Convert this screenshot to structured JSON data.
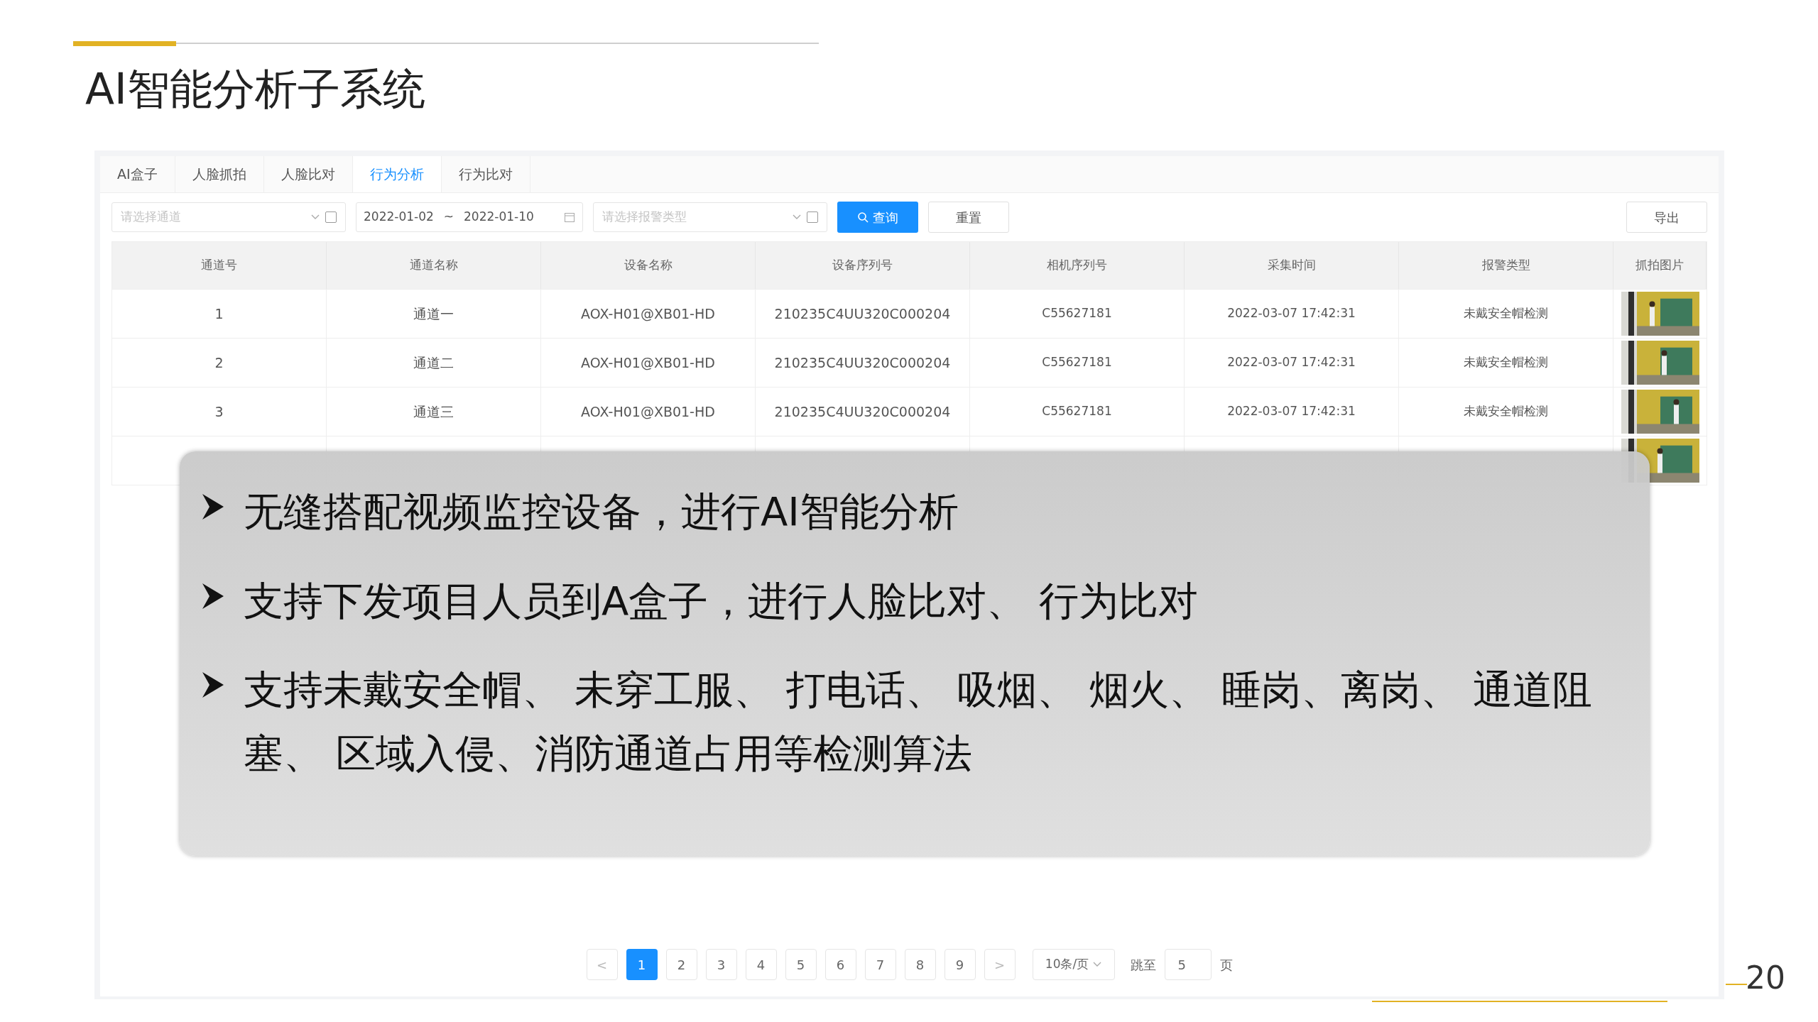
{
  "slide": {
    "title": "AI智能分析子系统",
    "page_number": "20"
  },
  "tabs": [
    {
      "label": "AI盒子",
      "selected": false
    },
    {
      "label": "人脸抓拍",
      "selected": false
    },
    {
      "label": "人脸比对",
      "selected": false
    },
    {
      "label": "行为分析",
      "selected": true
    },
    {
      "label": "行为比对",
      "selected": false
    }
  ],
  "filters": {
    "channel": {
      "placeholder": "请选择通道",
      "checked": false
    },
    "date_from": "2022-01-02",
    "date_sep": "~",
    "date_to": "2022-01-10",
    "alarm_type": {
      "placeholder": "请选择报警类型",
      "checked": false
    },
    "query_button": "查询",
    "reset_button": "重置",
    "export_button": "导出"
  },
  "table": {
    "columns": [
      "通道号",
      "通道名称",
      "设备名称",
      "设备序列号",
      "相机序列号",
      "采集时间",
      "报警类型",
      "抓拍图片"
    ],
    "rows": [
      {
        "cells": [
          "1",
          "通道一",
          "AOX-H01@XB01-HD",
          "210235C4UU320C000204",
          "C55627181",
          "2022-03-07 17:42:31",
          "未戴安全帽检测"
        ],
        "snapshot": {
          "kind": "picture"
        }
      },
      {
        "cells": [
          "2",
          "通道二",
          "AOX-H01@XB01-HD",
          "210235C4UU320C000204",
          "C55627181",
          "2022-03-07 17:42:31",
          "未戴安全帽检测"
        ],
        "snapshot": {
          "kind": "picture"
        }
      },
      {
        "cells": [
          "3",
          "通道三",
          "AOX-H01@XB01-HD",
          "210235C4UU320C000204",
          "C55627181",
          "2022-03-07 17:42:31",
          "未戴安全帽检测"
        ],
        "snapshot": {
          "kind": "picture"
        }
      },
      {
        "snapshot": {
          "kind": "picture"
        }
      }
    ]
  },
  "pagination": {
    "prev": "<",
    "pages": [
      {
        "label": "1",
        "selected": true
      },
      {
        "label": "2",
        "selected": false
      },
      {
        "label": "3",
        "selected": false
      },
      {
        "label": "4",
        "selected": false
      },
      {
        "label": "5",
        "selected": false
      },
      {
        "label": "6",
        "selected": false
      },
      {
        "label": "7",
        "selected": false
      },
      {
        "label": "8",
        "selected": false
      },
      {
        "label": "9",
        "selected": false
      }
    ],
    "next": ">",
    "page_size": "10条/页",
    "jump_label": "跳至",
    "jump_value": "5",
    "page_suffix": "页"
  },
  "callout": {
    "bullets": [
      "无缝搭配视频监控设备，进行AI智能分析",
      "支持下发项目人员到A盒子，进行人脸比对、 行为比对",
      "支持未戴安全帽、 未穿工服、 打电话、 吸烟、 烟火、 睡岗、离岗、 通道阻塞、 区域入侵、消防通道占用等检测算法"
    ]
  }
}
